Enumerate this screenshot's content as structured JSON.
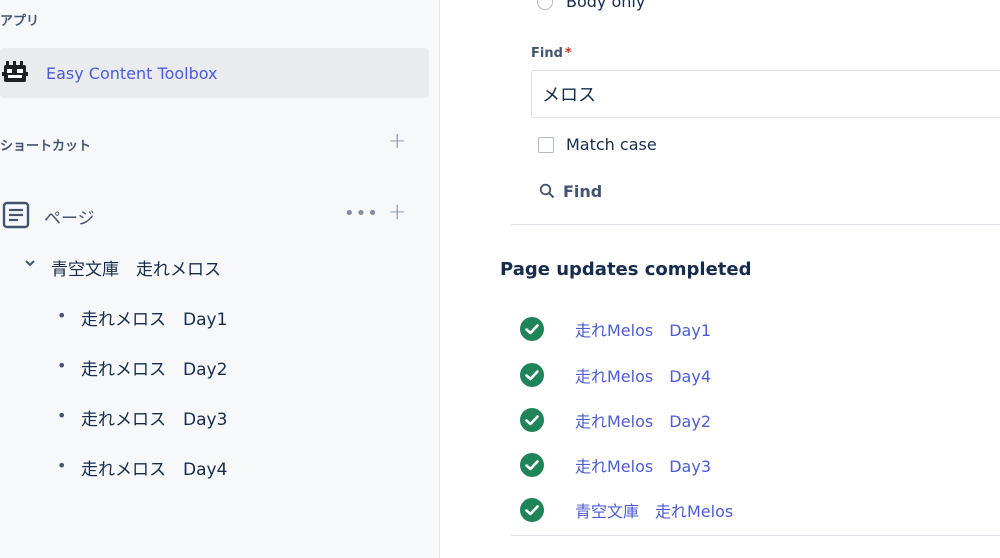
{
  "sidebar": {
    "apps_section_title": "アプリ",
    "app_item_label": "Easy Content Toolbox",
    "shortcuts_section_title": "ショートカット",
    "pages_label": "ページ",
    "tree": {
      "parent_label": "青空文庫　走れメロス",
      "children": [
        {
          "label": "走れメロス　Day1"
        },
        {
          "label": "走れメロス　Day2"
        },
        {
          "label": "走れメロス　Day3"
        },
        {
          "label": "走れメロス　Day4"
        }
      ]
    },
    "icons": {
      "add": "plus-icon",
      "more": "more-icon",
      "expand": "chevron-down-icon"
    }
  },
  "main": {
    "radio_body_only_label": "Body only",
    "find_label": "Find",
    "find_required_mark": "*",
    "find_value": "メロス",
    "match_case_label": "Match case",
    "find_button_label": "Find",
    "updates_title": "Page updates completed",
    "results": [
      {
        "label": "走れMelos　Day1"
      },
      {
        "label": "走れMelos　Day4"
      },
      {
        "label": "走れMelos　Day2"
      },
      {
        "label": "走れMelos　Day3"
      },
      {
        "label": "青空文庫　走れMelos"
      }
    ]
  },
  "colors": {
    "accent_link": "#4c5cd6",
    "success": "#1f845a",
    "required": "#c9372c",
    "sidebar_bg": "#f7f8f9",
    "selected_bg": "#e9ebee"
  }
}
